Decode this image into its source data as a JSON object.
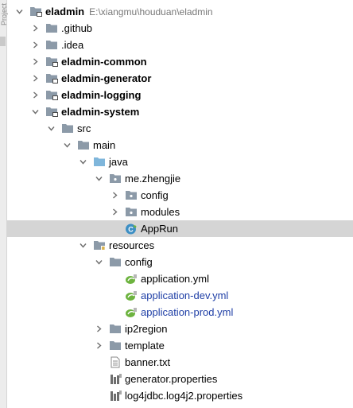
{
  "side_strip": {
    "text": "Project"
  },
  "colors": {
    "folder": "#8c9aa8",
    "source_folder": "#7fb6db",
    "resources_folder": "#8c9aa8",
    "spring": "#6db33f",
    "class_circle": "#3d8fc4",
    "selection": "#d5d5d5",
    "blue_text": "#1f3fa6"
  },
  "tree": [
    {
      "label": "eladmin",
      "path": "E:\\xiangmu\\houduan\\eladmin",
      "depth": 0,
      "arrow": "down",
      "icon": "module-folder-icon",
      "bold": true
    },
    {
      "label": ".github",
      "depth": 1,
      "arrow": "right",
      "icon": "folder-icon"
    },
    {
      "label": ".idea",
      "depth": 1,
      "arrow": "right",
      "icon": "folder-icon"
    },
    {
      "label": "eladmin-common",
      "depth": 1,
      "arrow": "right",
      "icon": "module-folder-icon",
      "bold": true
    },
    {
      "label": "eladmin-generator",
      "depth": 1,
      "arrow": "right",
      "icon": "module-folder-icon",
      "bold": true
    },
    {
      "label": "eladmin-logging",
      "depth": 1,
      "arrow": "right",
      "icon": "module-folder-icon",
      "bold": true
    },
    {
      "label": "eladmin-system",
      "depth": 1,
      "arrow": "down",
      "icon": "module-folder-icon",
      "bold": true
    },
    {
      "label": "src",
      "depth": 2,
      "arrow": "down",
      "icon": "folder-icon"
    },
    {
      "label": "main",
      "depth": 3,
      "arrow": "down",
      "icon": "folder-icon"
    },
    {
      "label": "java",
      "depth": 4,
      "arrow": "down",
      "icon": "source-folder-icon"
    },
    {
      "label": "me.zhengjie",
      "depth": 5,
      "arrow": "down",
      "icon": "package-icon"
    },
    {
      "label": "config",
      "depth": 6,
      "arrow": "right",
      "icon": "package-icon"
    },
    {
      "label": "modules",
      "depth": 6,
      "arrow": "right",
      "icon": "package-icon"
    },
    {
      "label": "AppRun",
      "depth": 6,
      "arrow": "none",
      "icon": "spring-class-icon",
      "selected": true
    },
    {
      "label": "resources",
      "depth": 4,
      "arrow": "down",
      "icon": "resources-folder-icon"
    },
    {
      "label": "config",
      "depth": 5,
      "arrow": "down",
      "icon": "folder-icon"
    },
    {
      "label": "application.yml",
      "depth": 6,
      "arrow": "none",
      "icon": "spring-yml-icon"
    },
    {
      "label": "application-dev.yml",
      "depth": 6,
      "arrow": "none",
      "icon": "spring-yml-icon",
      "blue": true
    },
    {
      "label": "application-prod.yml",
      "depth": 6,
      "arrow": "none",
      "icon": "spring-yml-icon",
      "blue": true
    },
    {
      "label": "ip2region",
      "depth": 5,
      "arrow": "right",
      "icon": "folder-icon"
    },
    {
      "label": "template",
      "depth": 5,
      "arrow": "right",
      "icon": "folder-icon"
    },
    {
      "label": "banner.txt",
      "depth": 5,
      "arrow": "none",
      "icon": "text-file-icon"
    },
    {
      "label": "generator.properties",
      "depth": 5,
      "arrow": "none",
      "icon": "properties-file-icon"
    },
    {
      "label": "log4jdbc.log4j2.properties",
      "depth": 5,
      "arrow": "none",
      "icon": "properties-file-icon"
    }
  ]
}
